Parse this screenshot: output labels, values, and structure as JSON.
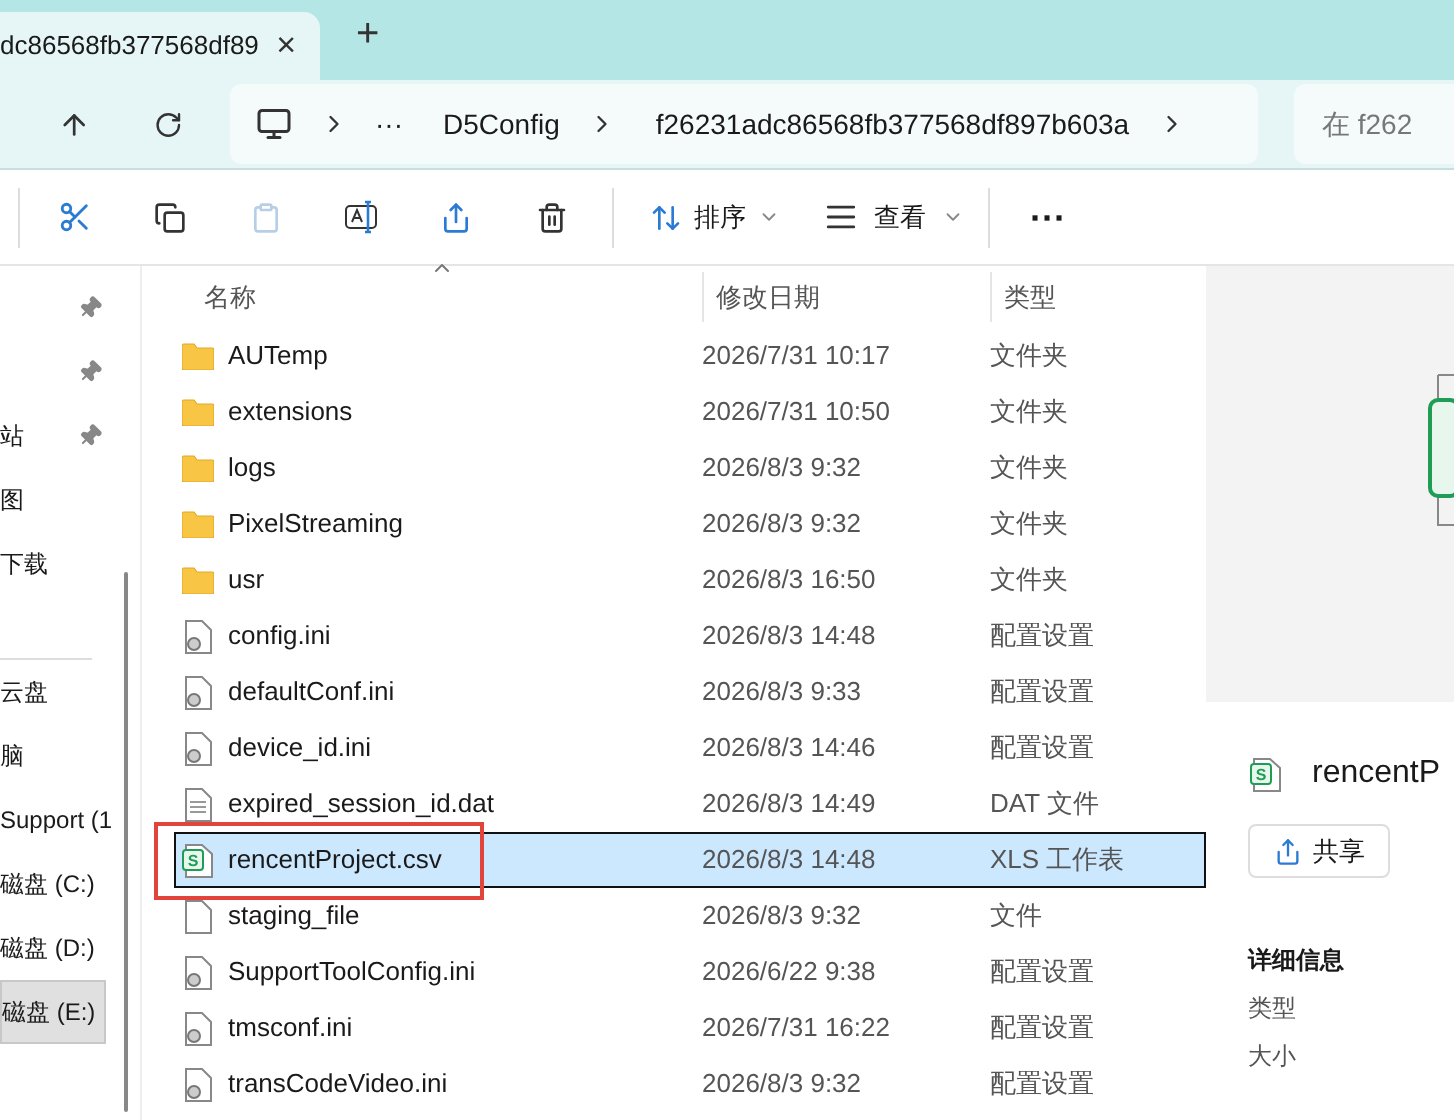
{
  "tab": {
    "title": "dc86568fb377568df89",
    "close": "×",
    "new_tab": "+"
  },
  "breadcrumb": {
    "ellipsis": "···",
    "items": [
      "D5Config",
      "f26231adc86568fb377568df897b603a"
    ]
  },
  "search": {
    "placeholder": "在 f262"
  },
  "toolbar": {
    "sort": "排序",
    "view": "查看",
    "more": "···"
  },
  "sidebar": {
    "items": [
      {
        "pinned": true,
        "selected": false
      },
      {
        "pinned": true,
        "selected": false
      },
      {
        "label": "站",
        "pinned": true,
        "selected": false
      },
      {
        "label": "图",
        "pinned": false,
        "selected": false
      },
      {
        "label": "下载",
        "pinned": false,
        "selected": false
      },
      {
        "label": "云盘",
        "pinned": false,
        "selected": false
      },
      {
        "label": "脑",
        "pinned": false,
        "selected": false
      },
      {
        "label": "Support (1",
        "pinned": false,
        "selected": false
      },
      {
        "label": "磁盘 (C:)",
        "pinned": false,
        "selected": false
      },
      {
        "label": "磁盘 (D:)",
        "pinned": false,
        "selected": false
      },
      {
        "label": "磁盘 (E:)",
        "pinned": false,
        "selected": true
      }
    ]
  },
  "table": {
    "columns": [
      "名称",
      "修改日期",
      "类型"
    ],
    "rows": [
      {
        "name": "AUTemp",
        "date": "2026/7/31 10:17",
        "type": "文件夹",
        "kind": "folder",
        "selected": false
      },
      {
        "name": "extensions",
        "date": "2026/7/31 10:50",
        "type": "文件夹",
        "kind": "folder",
        "selected": false
      },
      {
        "name": "logs",
        "date": "2026/8/3 9:32",
        "type": "文件夹",
        "kind": "folder",
        "selected": false
      },
      {
        "name": "PixelStreaming",
        "date": "2026/8/3 9:32",
        "type": "文件夹",
        "kind": "folder",
        "selected": false
      },
      {
        "name": "usr",
        "date": "2026/8/3 16:50",
        "type": "文件夹",
        "kind": "folder",
        "selected": false
      },
      {
        "name": "config.ini",
        "date": "2026/8/3 14:48",
        "type": "配置设置",
        "kind": "settings",
        "selected": false
      },
      {
        "name": "defaultConf.ini",
        "date": "2026/8/3 9:33",
        "type": "配置设置",
        "kind": "settings",
        "selected": false
      },
      {
        "name": "device_id.ini",
        "date": "2026/8/3 14:46",
        "type": "配置设置",
        "kind": "settings",
        "selected": false
      },
      {
        "name": "expired_session_id.dat",
        "date": "2026/8/3 14:49",
        "type": "DAT 文件",
        "kind": "text",
        "selected": false
      },
      {
        "name": "rencentProject.csv",
        "date": "2026/8/3 14:48",
        "type": "XLS 工作表",
        "kind": "sheet",
        "icon_letter": "S",
        "selected": true
      },
      {
        "name": "staging_file",
        "date": "2026/8/3 9:32",
        "type": "文件",
        "kind": "blank",
        "selected": false
      },
      {
        "name": "SupportToolConfig.ini",
        "date": "2026/6/22 9:38",
        "type": "配置设置",
        "kind": "settings",
        "selected": false
      },
      {
        "name": "tmsconf.ini",
        "date": "2026/7/31 16:22",
        "type": "配置设置",
        "kind": "settings",
        "selected": false
      },
      {
        "name": "transCodeVideo.ini",
        "date": "2026/8/3 9:32",
        "type": "配置设置",
        "kind": "settings",
        "selected": false
      }
    ]
  },
  "preview": {
    "icon_letter": "S",
    "file_name": "rencentP",
    "share": "共享",
    "details_heading": "详细信息",
    "detail_labels": [
      "类型",
      "大小"
    ]
  }
}
